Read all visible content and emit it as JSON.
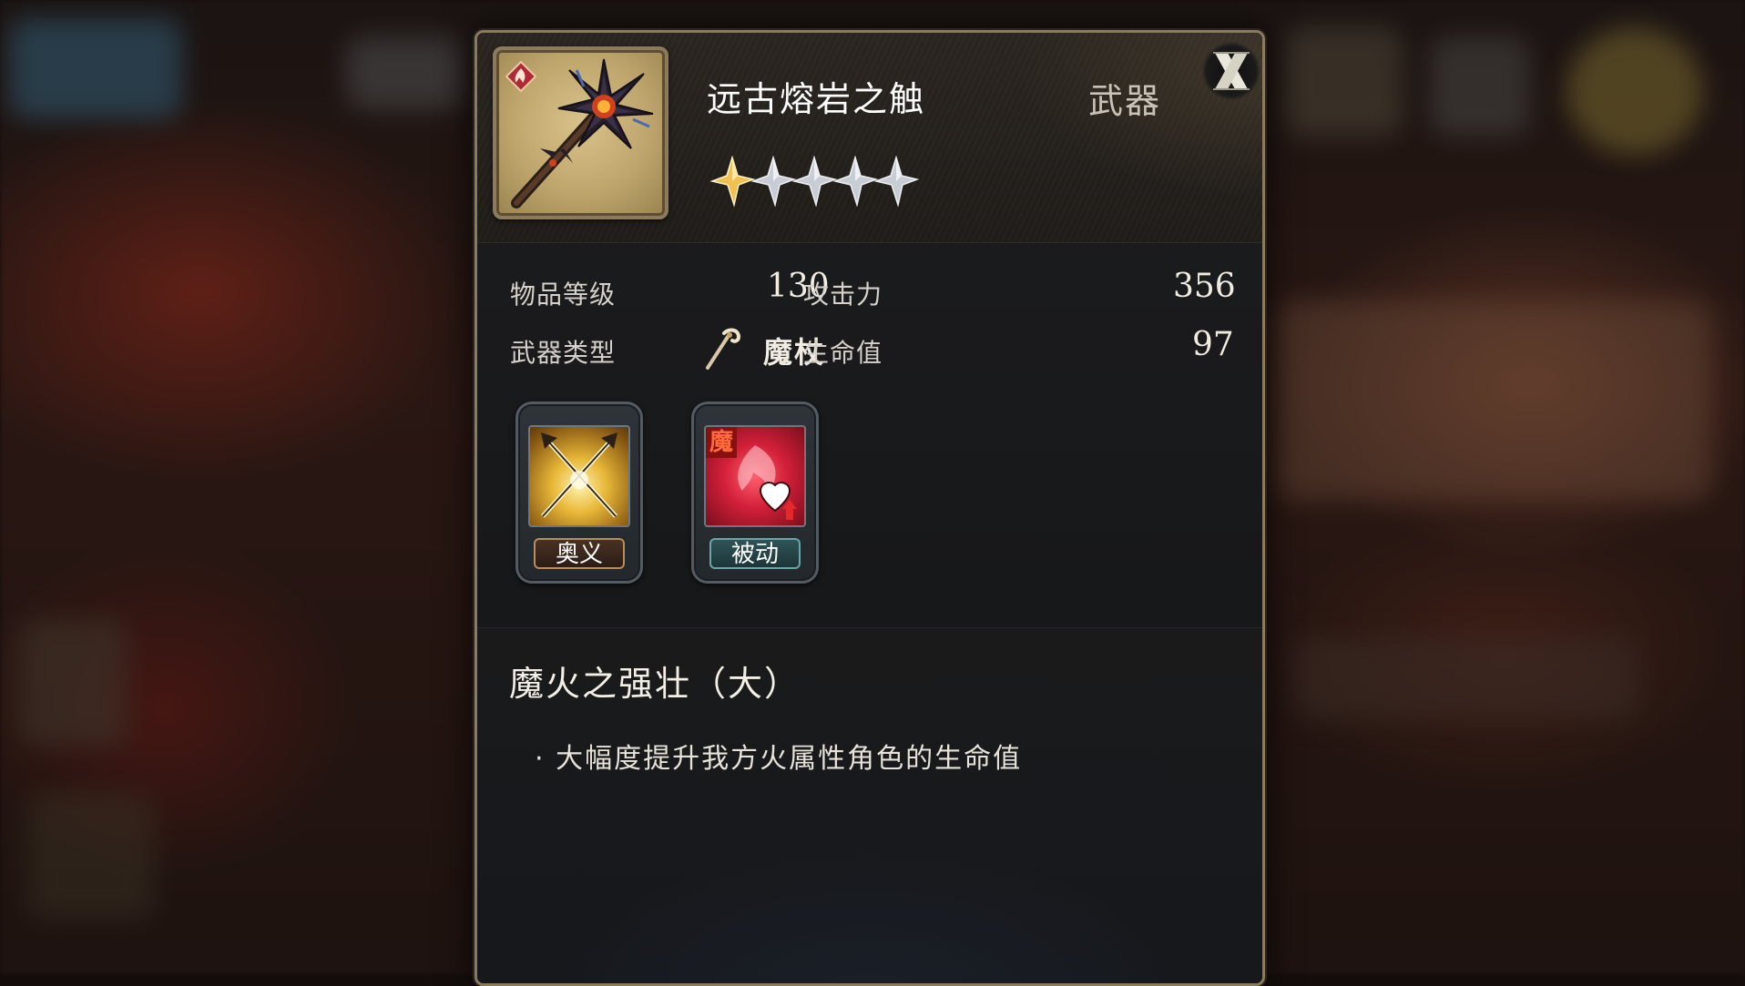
{
  "item": {
    "name": "远古熔岩之触",
    "category": "武器",
    "rarity_stars_filled": 1,
    "rarity_stars_total": 5,
    "icon": "molten-staff-icon",
    "element_icon": "fire-element-icon"
  },
  "stats": {
    "item_level_label": "物品等级",
    "item_level_value": "130",
    "weapon_type_label": "武器类型",
    "weapon_type_value": "魔杖",
    "attack_label": "攻击力",
    "attack_value": "356",
    "hp_label": "生命值",
    "hp_value": "97"
  },
  "skills": [
    {
      "tag": "奥义",
      "icon": "crossed-spears-icon"
    },
    {
      "tag": "被动",
      "icon": "fire-heart-up-icon",
      "badge": "魔"
    }
  ],
  "description": {
    "title": "魔火之强壮（大）",
    "line": "· 大幅度提升我方火属性角色的生命值"
  },
  "colors": {
    "panel_border": "#8a7a5e",
    "star_gold": "#f0c050",
    "star_silver": "#c8ccd4",
    "passive_red": "#d4203a"
  }
}
